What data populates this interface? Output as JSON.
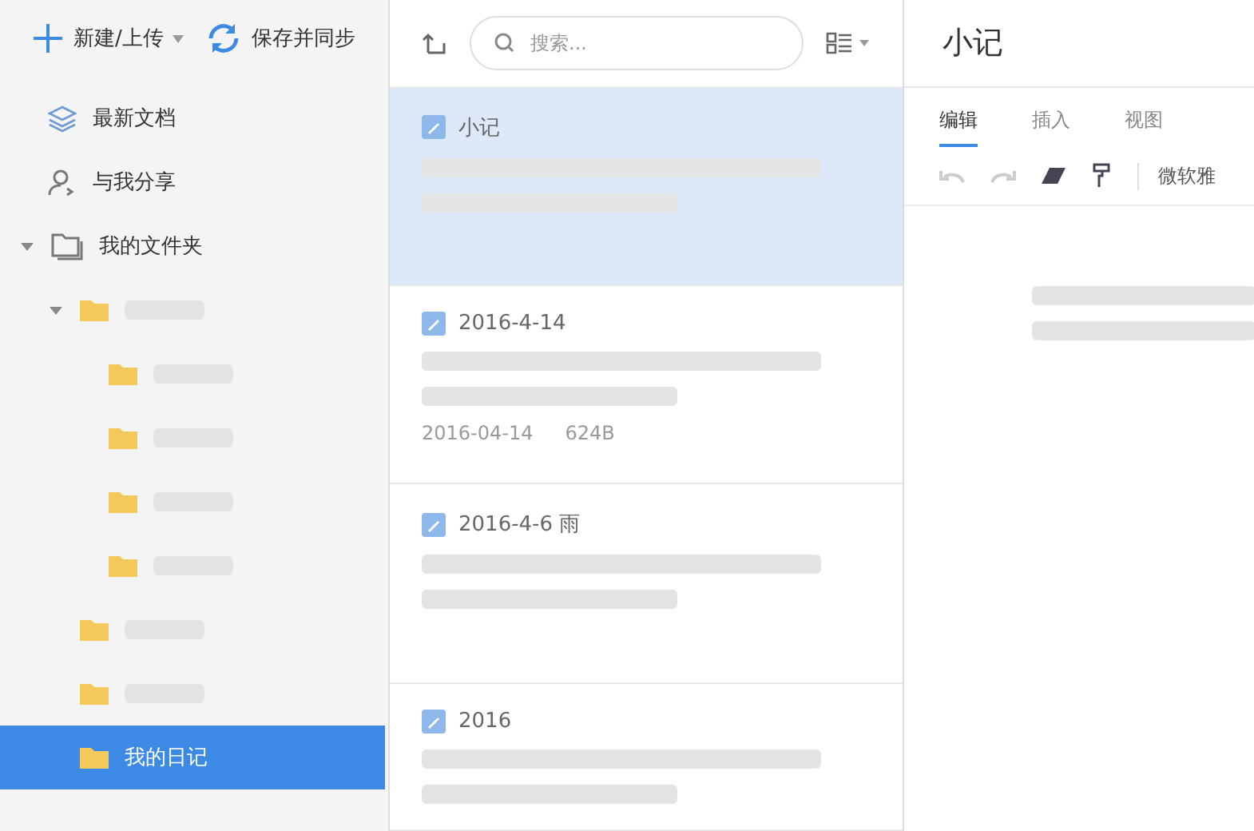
{
  "toolbar": {
    "new_label": "新建/上传",
    "sync_label": "保存并同步"
  },
  "sidebar": {
    "items": [
      {
        "label": "最新文档",
        "kind": "recent",
        "selected": false
      },
      {
        "label": "与我分享",
        "kind": "shared",
        "selected": false
      }
    ],
    "tree": [
      {
        "label": "我的文件夹",
        "expanded": true,
        "selected": false,
        "children": [
          {
            "expanded": true,
            "selected": false,
            "children": [
              {
                "selected": false
              },
              {
                "selected": false
              },
              {
                "selected": false
              },
              {
                "selected": false
              }
            ]
          },
          {
            "selected": false
          },
          {
            "selected": false
          },
          {
            "label": "我的日记",
            "selected": true
          }
        ]
      }
    ]
  },
  "search": {
    "placeholder": "搜索..."
  },
  "notes": [
    {
      "title": "小记",
      "selected": true
    },
    {
      "title": "2016-4-14",
      "date": "2016-04-14",
      "size": "624B",
      "selected": false
    },
    {
      "title": "2016-4-6 雨",
      "selected": false
    },
    {
      "title": "2016",
      "selected": false
    }
  ],
  "editor": {
    "title": "小记",
    "tabs": [
      {
        "label": "编辑",
        "selected": true
      },
      {
        "label": "插入",
        "selected": false
      },
      {
        "label": "视图",
        "selected": false
      }
    ],
    "font": "微软雅"
  }
}
